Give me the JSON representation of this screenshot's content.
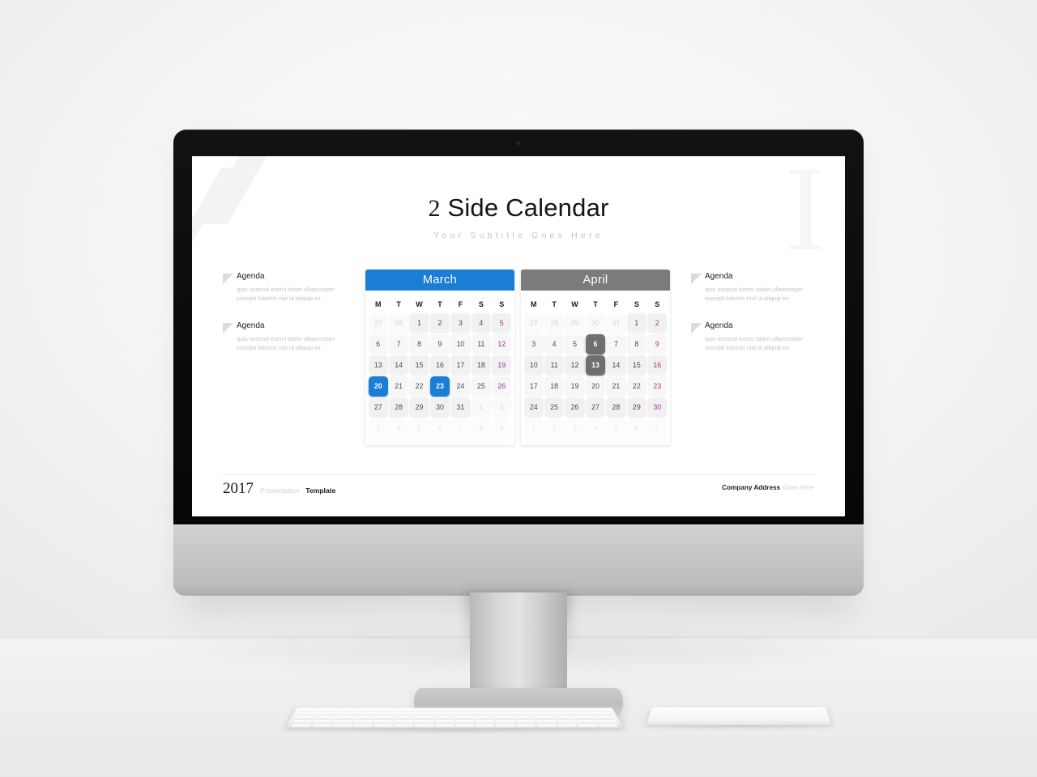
{
  "slide": {
    "title_numeral": "2",
    "title_rest": " Side Calendar",
    "subtitle": "Your Subtitle Goes Here",
    "watermark": "I"
  },
  "agenda_left": [
    {
      "heading": "Agenda",
      "body": "quis nostrud exerci tation ullamcorper suscipit lobortis nisl ut aliquip ex"
    },
    {
      "heading": "Agenda",
      "body": "quis nostrud exerci tation ullamcorper suscipit lobortis nisl ut aliquip ex"
    }
  ],
  "agenda_right": [
    {
      "heading": "Agenda",
      "body": "quis nostrud exerci tation ullamcorper suscipit lobortis nisl ut aliquip ex"
    },
    {
      "heading": "Agenda",
      "body": "quis nostrud exerci tation ullamcorper suscipit lobortis nisl ut aliquip ex"
    }
  ],
  "calendars": [
    {
      "month": "March",
      "accent": "#1a7ed4",
      "dow": [
        "M",
        "T",
        "W",
        "T",
        "F",
        "S",
        "S"
      ],
      "weeks": [
        [
          {
            "d": "27",
            "state": "out"
          },
          {
            "d": "28",
            "state": "out"
          },
          {
            "d": "1",
            "state": "in"
          },
          {
            "d": "2",
            "state": "in"
          },
          {
            "d": "3",
            "state": "in"
          },
          {
            "d": "4",
            "state": "in"
          },
          {
            "d": "5",
            "state": "sun"
          }
        ],
        [
          {
            "d": "6",
            "state": "in"
          },
          {
            "d": "7",
            "state": "in"
          },
          {
            "d": "8",
            "state": "in"
          },
          {
            "d": "9",
            "state": "in"
          },
          {
            "d": "10",
            "state": "in"
          },
          {
            "d": "11",
            "state": "in"
          },
          {
            "d": "12",
            "state": "sun"
          }
        ],
        [
          {
            "d": "13",
            "state": "in"
          },
          {
            "d": "14",
            "state": "in"
          },
          {
            "d": "15",
            "state": "in"
          },
          {
            "d": "16",
            "state": "in"
          },
          {
            "d": "17",
            "state": "in"
          },
          {
            "d": "18",
            "state": "in"
          },
          {
            "d": "19",
            "state": "sun"
          }
        ],
        [
          {
            "d": "20",
            "state": "selected"
          },
          {
            "d": "21",
            "state": "in"
          },
          {
            "d": "22",
            "state": "in"
          },
          {
            "d": "23",
            "state": "selected"
          },
          {
            "d": "24",
            "state": "in"
          },
          {
            "d": "25",
            "state": "in"
          },
          {
            "d": "26",
            "state": "sun"
          }
        ],
        [
          {
            "d": "27",
            "state": "in"
          },
          {
            "d": "28",
            "state": "in"
          },
          {
            "d": "29",
            "state": "in"
          },
          {
            "d": "30",
            "state": "in"
          },
          {
            "d": "31",
            "state": "in"
          },
          {
            "d": "1",
            "state": "out"
          },
          {
            "d": "2",
            "state": "out"
          }
        ],
        [
          {
            "d": "3",
            "state": "faint"
          },
          {
            "d": "4",
            "state": "faint"
          },
          {
            "d": "5",
            "state": "faint"
          },
          {
            "d": "6",
            "state": "faint"
          },
          {
            "d": "7",
            "state": "faint"
          },
          {
            "d": "8",
            "state": "faint"
          },
          {
            "d": "9",
            "state": "faint"
          }
        ]
      ]
    },
    {
      "month": "April",
      "accent": "#7b7b7b",
      "dow": [
        "M",
        "T",
        "W",
        "T",
        "F",
        "S",
        "S"
      ],
      "weeks": [
        [
          {
            "d": "27",
            "state": "out"
          },
          {
            "d": "28",
            "state": "out"
          },
          {
            "d": "29",
            "state": "out"
          },
          {
            "d": "30",
            "state": "out"
          },
          {
            "d": "31",
            "state": "out"
          },
          {
            "d": "1",
            "state": "in"
          },
          {
            "d": "2",
            "state": "sun"
          }
        ],
        [
          {
            "d": "3",
            "state": "in"
          },
          {
            "d": "4",
            "state": "in"
          },
          {
            "d": "5",
            "state": "in"
          },
          {
            "d": "6",
            "state": "selected"
          },
          {
            "d": "7",
            "state": "in"
          },
          {
            "d": "8",
            "state": "in"
          },
          {
            "d": "9",
            "state": "sun"
          }
        ],
        [
          {
            "d": "10",
            "state": "in"
          },
          {
            "d": "11",
            "state": "in"
          },
          {
            "d": "12",
            "state": "in"
          },
          {
            "d": "13",
            "state": "selected"
          },
          {
            "d": "14",
            "state": "in"
          },
          {
            "d": "15",
            "state": "in"
          },
          {
            "d": "16",
            "state": "sun"
          }
        ],
        [
          {
            "d": "17",
            "state": "in"
          },
          {
            "d": "18",
            "state": "in"
          },
          {
            "d": "19",
            "state": "in"
          },
          {
            "d": "20",
            "state": "in"
          },
          {
            "d": "21",
            "state": "in"
          },
          {
            "d": "22",
            "state": "in"
          },
          {
            "d": "23",
            "state": "sun"
          }
        ],
        [
          {
            "d": "24",
            "state": "in"
          },
          {
            "d": "25",
            "state": "in"
          },
          {
            "d": "26",
            "state": "in"
          },
          {
            "d": "27",
            "state": "in"
          },
          {
            "d": "28",
            "state": "in"
          },
          {
            "d": "29",
            "state": "in"
          },
          {
            "d": "30",
            "state": "sun"
          }
        ],
        [
          {
            "d": "1",
            "state": "faint"
          },
          {
            "d": "2",
            "state": "faint"
          },
          {
            "d": "3",
            "state": "faint"
          },
          {
            "d": "4",
            "state": "faint"
          },
          {
            "d": "5",
            "state": "faint"
          },
          {
            "d": "6",
            "state": "faint"
          },
          {
            "d": "7",
            "state": "faint"
          }
        ]
      ]
    }
  ],
  "footer": {
    "year": "2017",
    "presentation": "Presentation",
    "template": "Template",
    "company": "Company Address",
    "company_rest": " Goes Here"
  }
}
